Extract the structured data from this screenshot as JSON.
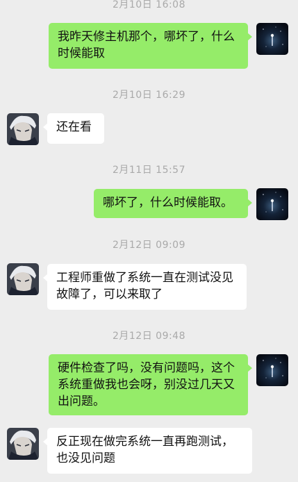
{
  "messages": [
    {
      "type": "timestamp",
      "text": "2月10日 16:08"
    },
    {
      "type": "sent",
      "avatar": "self-avatar",
      "text": "我昨天修主机那个，哪坏了，什么时候能取"
    },
    {
      "type": "timestamp",
      "text": "2月10日 16:29"
    },
    {
      "type": "received",
      "avatar": "contact-avatar",
      "text": "还在看"
    },
    {
      "type": "timestamp",
      "text": "2月11日 15:57"
    },
    {
      "type": "sent",
      "avatar": "self-avatar",
      "text": "哪坏了，什么时候能取。"
    },
    {
      "type": "timestamp",
      "text": "2月12日 09:09"
    },
    {
      "type": "received",
      "avatar": "contact-avatar",
      "text": "工程师重做了系统一直在测试没见故障了，可以来取了"
    },
    {
      "type": "timestamp",
      "text": "2月12日 09:48"
    },
    {
      "type": "sent",
      "avatar": "self-avatar",
      "text": "硬件检查了吗，没有问题吗，这个系统重做我也会呀，别没过几天又出问题。"
    },
    {
      "type": "received",
      "avatar": "contact-avatar",
      "text": "反正现在做完系统一直再跑测试，也没见问题"
    }
  ],
  "colors": {
    "background": "#ededed",
    "sent_bubble": "#95ec69",
    "received_bubble": "#ffffff",
    "timestamp_text": "#a9a9a9"
  }
}
